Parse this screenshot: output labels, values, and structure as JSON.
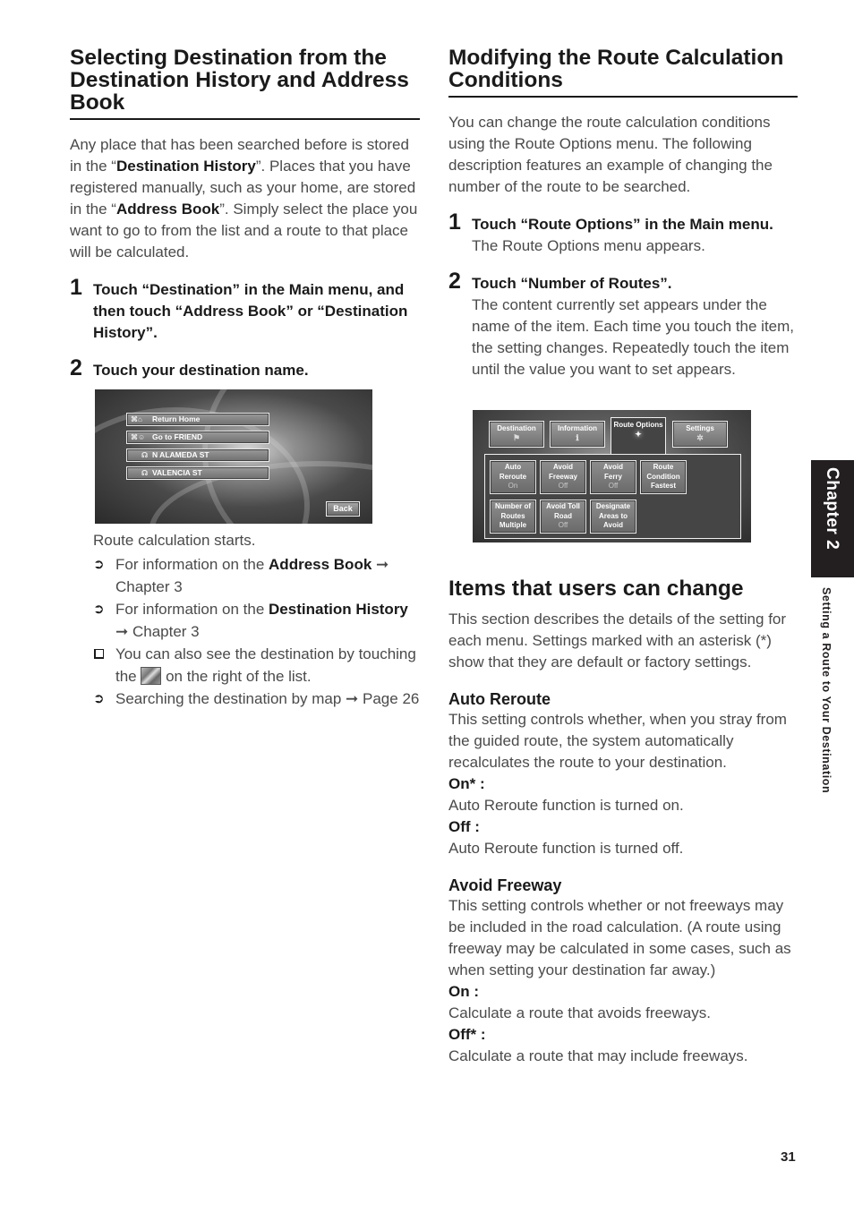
{
  "left": {
    "title": "Selecting Destination from the Destination History and Address Book",
    "intro": [
      {
        "t": "Any place that has been searched before is stored in the “",
        "b": false
      },
      {
        "t": "Destination History",
        "b": true
      },
      {
        "t": "”. Places that you have registered manually, such as your home, are stored in the “",
        "b": false
      },
      {
        "t": "Address Book",
        "b": true
      },
      {
        "t": "”. Simply select the place you want to go to from the list and a route to that place will be calculated.",
        "b": false
      }
    ],
    "steps": [
      {
        "num": "1",
        "instruction": "Touch “Destination” in the Main menu, and then touch “Address Book” or “Destination History”."
      },
      {
        "num": "2",
        "instruction": "Touch your destination name."
      }
    ],
    "screen": {
      "items": [
        {
          "icon": "⌘⌂",
          "label": "Return Home"
        },
        {
          "icon": "⌘☺",
          "label": "Go to FRIEND"
        },
        {
          "icon": "☊",
          "label": "N ALAMEDA ST"
        },
        {
          "icon": "☊",
          "label": "VALENCIA ST"
        }
      ],
      "back_label": "Back"
    },
    "after_screen": "Route calculation starts.",
    "notes": {
      "n1_pre": "For information on the ",
      "n1_bold": "Address Book",
      "n1_post": " ➞ Chapter 3",
      "n2_pre": "For information on the ",
      "n2_bold": "Destination History",
      "n2_post": " ➞ Chapter 3",
      "n3_pre": "You can also see the destination by touching the ",
      "n3_post": " on the right of the list.",
      "n4": "Searching the destination by map ➞ Page 26"
    }
  },
  "right": {
    "title": "Modifying the Route Calculation Conditions",
    "intro": "You can change the route calculation conditions using the Route Options menu. The following description features an example of changing the number of the route to be searched.",
    "steps": [
      {
        "num": "1",
        "instruction": "Touch “Route Options” in the Main menu.",
        "result": "The Route Options menu appears."
      },
      {
        "num": "2",
        "instruction": "Touch “Number of Routes”.",
        "result": "The content currently set appears under the name of the item. Each time you touch the item, the setting changes. Repeatedly touch the item until the value you want to set appears."
      }
    ],
    "screen": {
      "tabs": [
        {
          "label": "Destination",
          "icon": "⚑"
        },
        {
          "label": "Information",
          "icon": "ℹ"
        },
        {
          "label": "Route Options",
          "icon": "✦"
        },
        {
          "label": "Settings",
          "icon": "✲"
        }
      ],
      "active_tab": "Route Options",
      "options": [
        {
          "l1": "Auto",
          "l2": "Reroute",
          "value": "On"
        },
        {
          "l1": "Avoid",
          "l2": "Freeway",
          "value": "Off"
        },
        {
          "l1": "Avoid",
          "l2": "Ferry",
          "value": "Off"
        },
        {
          "l1": "Route",
          "l2": "Condition",
          "value": "Fastest"
        },
        {
          "l1": "Number of",
          "l2": "Routes",
          "value": "Multiple"
        },
        {
          "l1": "Avoid Toll",
          "l2": "Road",
          "value": "Off"
        },
        {
          "l1": "Designate",
          "l2": "Areas to",
          "value": "Avoid"
        }
      ]
    },
    "items_title": "Items that users can change",
    "items_intro": "This section describes the details of the setting for each menu. Settings marked with an asterisk (*) show that they are default or factory settings.",
    "auto_reroute": {
      "title": "Auto Reroute",
      "desc": "This setting controls whether, when you stray from the guided route, the system automatically recalculates the route to your destination.",
      "on_label": "On* :",
      "on_desc": "Auto Reroute function is turned on.",
      "off_label": "Off :",
      "off_desc": "Auto Reroute function is turned off."
    },
    "avoid_freeway": {
      "title": "Avoid Freeway",
      "desc": "This setting controls whether or not freeways may be included in the road calculation. (A route using freeway may be calculated in some cases, such as when setting your destination far away.)",
      "on_label": "On :",
      "on_desc": "Calculate a route that avoids freeways.",
      "off_label": "Off* :",
      "off_desc": "Calculate a route that may include freeways."
    }
  },
  "side": {
    "chapter": "Chapter 2",
    "section": "Setting a Route to Your Destination"
  },
  "page_number": "31"
}
